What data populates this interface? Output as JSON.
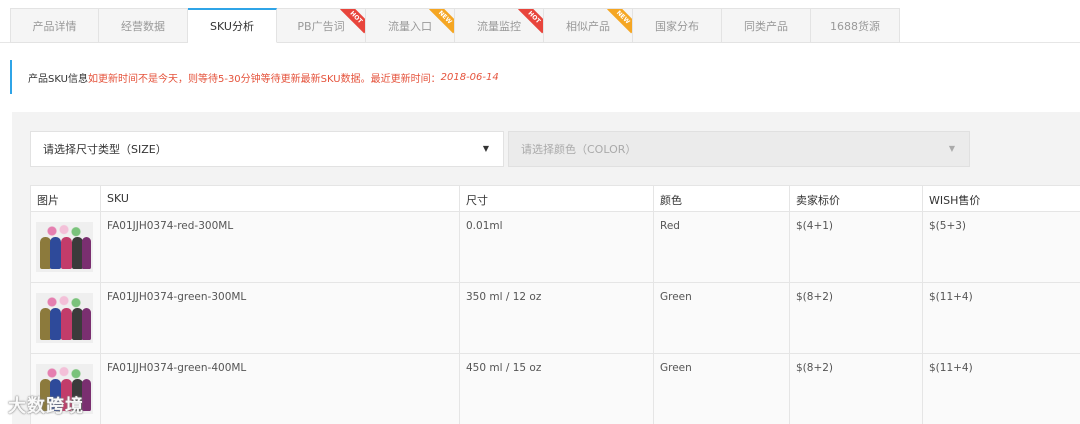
{
  "tabs": [
    {
      "label": "产品详情",
      "badge": ""
    },
    {
      "label": "经营数据",
      "badge": ""
    },
    {
      "label": "SKU分析",
      "badge": "",
      "active": true
    },
    {
      "label": "PB广告词",
      "badge": "HOT"
    },
    {
      "label": "流量入口",
      "badge": "NEW"
    },
    {
      "label": "流量监控",
      "badge": "HOT"
    },
    {
      "label": "相似产品",
      "badge": "NEW"
    },
    {
      "label": "国家分布",
      "badge": ""
    },
    {
      "label": "同类产品",
      "badge": ""
    },
    {
      "label": "1688货源",
      "badge": ""
    }
  ],
  "notice": {
    "label": "产品SKU信息",
    "message": "如更新时间不是今天，则等待5-30分钟等待更新最新SKU数据。最近更新时间：",
    "date": "2018-06-14"
  },
  "filters": {
    "size_select": "请选择尺寸类型（SIZE）",
    "color_select": "请选择颜色（COLOR）"
  },
  "table": {
    "headers": [
      "图片",
      "SKU",
      "尺寸",
      "颜色",
      "卖家标价",
      "WISH售价"
    ],
    "rows": [
      {
        "sku": "FA01JJH0374-red-300ML",
        "size": "0.01ml",
        "color": "Red",
        "seller_price": "$(4+1)",
        "wish_price": "$(5+3)"
      },
      {
        "sku": "FA01JJH0374-green-300ML",
        "size": "350 ml / 12 oz",
        "color": "Green",
        "seller_price": "$(8+2)",
        "wish_price": "$(11+4)"
      },
      {
        "sku": "FA01JJH0374-green-400ML",
        "size": "450 ml / 15 oz",
        "color": "Green",
        "seller_price": "$(8+2)",
        "wish_price": "$(11+4)"
      }
    ]
  },
  "watermark": "大数跨境",
  "colors": {
    "accent": "#2fa4e7",
    "warning_text": "#e5533c",
    "hot": "#e8453c",
    "new": "#f5a623"
  }
}
